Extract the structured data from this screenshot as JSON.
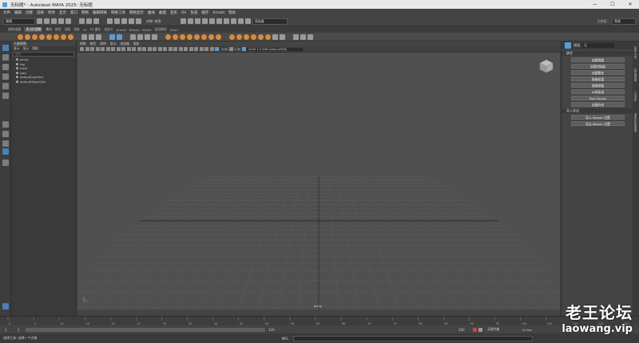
{
  "window": {
    "title": "无标题* - Autodesk MAYA 2025: 无标题",
    "minimize": "—",
    "maximize": "☐",
    "close": "✕"
  },
  "menubar": {
    "items": [
      "文件",
      "编辑",
      "创建",
      "选择",
      "修改",
      "显示",
      "窗口",
      "网格",
      "编辑网格",
      "网格工具",
      "网格显示",
      "曲线",
      "曲面",
      "变形",
      "UV",
      "生成",
      "缓存",
      "Arnold",
      "帮助"
    ],
    "workspace_label": "工作区:",
    "workspace_value": "常规"
  },
  "toolbar": {
    "mode_value": "建模",
    "symmetry_label": "对称: 禁用",
    "renderer_value": "渲染器"
  },
  "shelf_tabs": {
    "items": [
      "曲线/曲面",
      "多边形建模",
      "雕刻",
      "绑定",
      "动画",
      "渲染",
      "FX",
      "FX 缓存",
      "自定义",
      "Arnold",
      "Bifrost",
      "MASH",
      "运动图形",
      "XGen"
    ],
    "active_index": 1
  },
  "outliner": {
    "title": "大纲视图",
    "menus": [
      "显示",
      "显示",
      "帮助"
    ],
    "search_placeholder": "搜索...",
    "items": [
      "persp",
      "top",
      "front",
      "side",
      "defaultLightSet",
      "defaultObjectSet"
    ]
  },
  "viewport": {
    "menus": [
      "视图",
      "着色",
      "照明",
      "显示",
      "渲染器",
      "面板"
    ],
    "exposure": "0.00",
    "gamma": "1.00",
    "colorspace": "ACES 1.0 SDR-video (sRGB)",
    "camera_label": "persp"
  },
  "right_panel": {
    "title_label": "通道",
    "workspace_dropdown": "无",
    "section1": "绑定",
    "buttons1": [
      "创建骨骼",
      "创建控制器",
      "创建蒙皮",
      "镜像权重",
      "镜像骨骼",
      "IK样条线",
      "Pole Vector",
      "创建约束"
    ],
    "section2": "导入导出",
    "buttons2": [
      "导入 Marker 位置",
      "导出 Marker 位置"
    ],
    "tabs": [
      "建模工具包",
      "属性编辑器",
      "工具设置",
      "通道盒/层编辑器"
    ]
  },
  "timeline": {
    "ticks": [
      "0",
      "5",
      "10",
      "15",
      "20",
      "25",
      "30",
      "35",
      "40",
      "45",
      "50",
      "55",
      "60",
      "65",
      "70",
      "75",
      "80",
      "85",
      "90",
      "95",
      "100",
      "105",
      "110",
      "115",
      "120"
    ],
    "range_start": "1",
    "range_end": "120",
    "playback_end": "200",
    "current_frame": "1",
    "anim_layer": "无角色集",
    "fps_label": "24 fps"
  },
  "statusbar": {
    "mode": "MEL",
    "message": "选择工具: 选择一个对象"
  },
  "watermark": {
    "cn": "老王论坛",
    "en": "laowang.vip"
  }
}
